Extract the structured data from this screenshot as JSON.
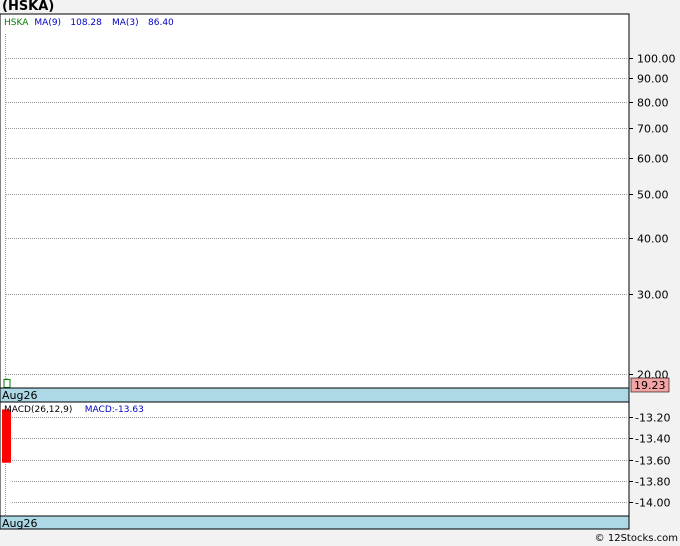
{
  "title": "(HSKA)",
  "footer": "© 12Stocks.com",
  "chart_data": [
    {
      "type": "line",
      "scale": "log",
      "legend": [
        {
          "text": "HSKA",
          "color": "#008000"
        },
        {
          "text": "MA(9)",
          "color": "#0000cc"
        },
        {
          "text": "108.28",
          "color": "#0000cc"
        },
        {
          "text": "MA(3)",
          "color": "#0000cc"
        },
        {
          "text": "86.40",
          "color": "#0000cc"
        }
      ],
      "yticks": [
        100,
        90,
        80,
        70,
        60,
        50,
        40,
        30,
        20
      ],
      "ytick_labels": [
        "100.00",
        "90.00",
        "80.00",
        "70.00",
        "60.00",
        "50.00",
        "40.00",
        "30.00",
        "20.00"
      ],
      "ylim": [
        18.6,
        125
      ],
      "x": [
        "Aug26"
      ],
      "candles": [
        {
          "date": "Aug26",
          "open": 19.1,
          "high": 19.23,
          "low": 18.9,
          "close": 19.23
        }
      ],
      "last_price": "19.23",
      "date_labels": [
        "Aug26"
      ],
      "grid": true
    },
    {
      "type": "bar",
      "legend": [
        {
          "text": "MACD(26,12,9)",
          "color": "#000000"
        },
        {
          "text": "MACD:-13.63",
          "color": "#0000cc"
        }
      ],
      "yticks": [
        -13.2,
        -13.4,
        -13.6,
        -13.8,
        -14.0
      ],
      "ytick_labels": [
        "-13.20",
        "-13.40",
        "-13.60",
        "-13.80",
        "-14.00"
      ],
      "ylim": [
        -14.13,
        -13.06
      ],
      "x": [
        "Aug26"
      ],
      "values": [
        -13.63
      ],
      "bar_top_value": -13.13,
      "bar_color": "#ff0000",
      "date_labels": [
        "Aug26"
      ],
      "grid": true
    }
  ]
}
